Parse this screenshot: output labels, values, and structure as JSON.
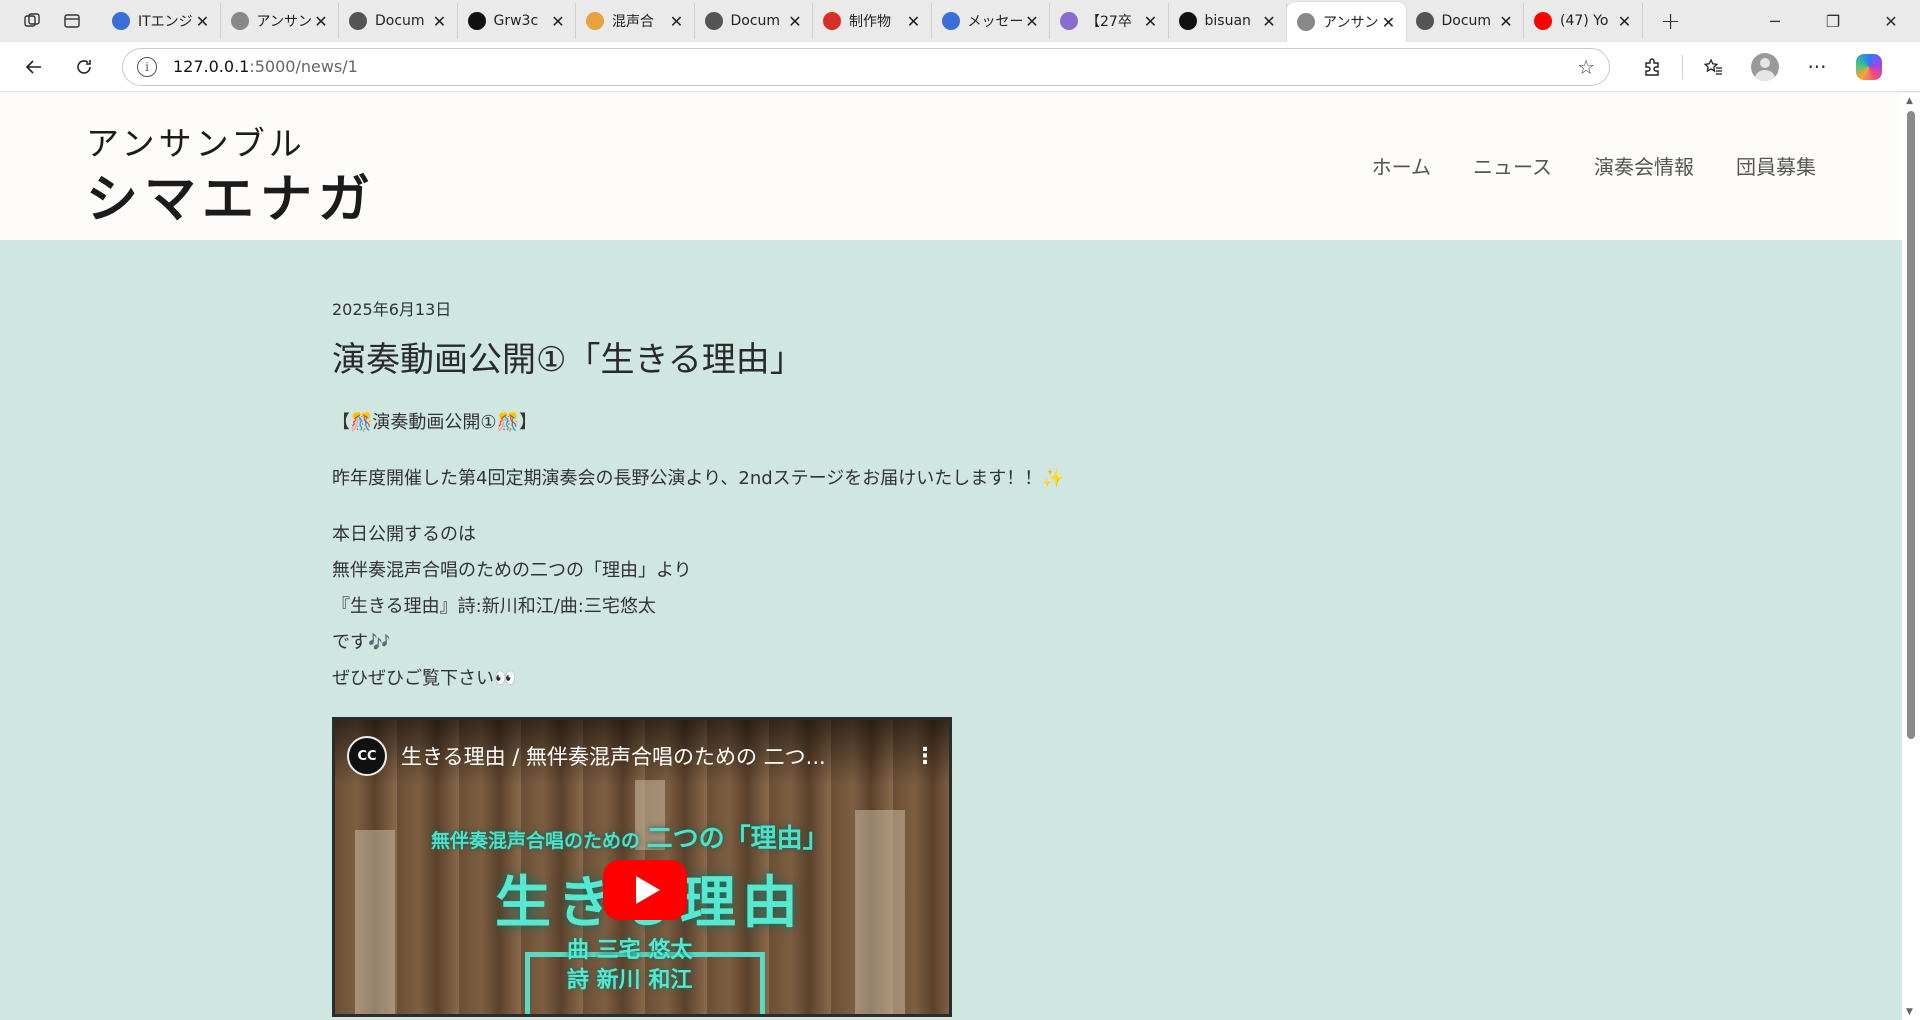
{
  "browser": {
    "tabs": [
      {
        "label": "ITエンジ",
        "icon": "edge-icon",
        "color": "#3a6fd8"
      },
      {
        "label": "アンサン",
        "icon": "site-logo-icon",
        "color": "#888888"
      },
      {
        "label": "Docum",
        "icon": "globe-icon",
        "color": "#555555"
      },
      {
        "label": "Grw3c",
        "icon": "x-icon",
        "color": "#111111"
      },
      {
        "label": "混声合",
        "icon": "sparkle-icon",
        "color": "#e6a23c"
      },
      {
        "label": "Docum",
        "icon": "globe-icon",
        "color": "#555555"
      },
      {
        "label": "制作物",
        "icon": "gmail-icon",
        "color": "#d93025"
      },
      {
        "label": "メッセー",
        "icon": "edge-icon",
        "color": "#3a6fd8"
      },
      {
        "label": "【27卒",
        "icon": "list-icon",
        "color": "#8a6bd1"
      },
      {
        "label": "bisuan",
        "icon": "github-icon",
        "color": "#111111"
      },
      {
        "label": "アンサン",
        "icon": "site-logo-icon",
        "color": "#888888",
        "active": true
      },
      {
        "label": "Docum",
        "icon": "globe-icon",
        "color": "#555555"
      },
      {
        "label": "(47) Yo",
        "icon": "youtube-icon",
        "color": "#ff0000"
      }
    ],
    "address": {
      "host": "127.0.0.1",
      "path": ":5000/news/1"
    }
  },
  "site": {
    "logo_line1": "アンサンブル",
    "logo_line2": "シマエナガ",
    "nav": [
      "ホーム",
      "ニュース",
      "演奏会情報",
      "団員募集"
    ]
  },
  "article": {
    "date": "2025年6月13日",
    "title": "演奏動画公開①「生きる理由」",
    "heading_line": "【🎊演奏動画公開①🎊】",
    "intro": "昨年度開催した第4回定期演奏会の長野公演より、2ndステージをお届けいたします！！✨",
    "body_lines": [
      "本日公開するのは",
      "無伴奏混声合唱のための二つの「理由」より",
      "『生きる理由』詩:新川和江/曲:三宅悠太",
      "です🎶",
      "ぜひぜひご覧下さい👀"
    ]
  },
  "video": {
    "channel_badge": "CC",
    "title": "生きる理由 / 無伴奏混声合唱のための 二つ...",
    "overlay_sub": "無伴奏混声合唱のための",
    "overlay_sub_big": "二つの「理由」",
    "overlay_title": "生きる理由",
    "overlay_credit_1": "曲 三宅 悠太",
    "overlay_credit_2": "詩 新川 和江"
  }
}
